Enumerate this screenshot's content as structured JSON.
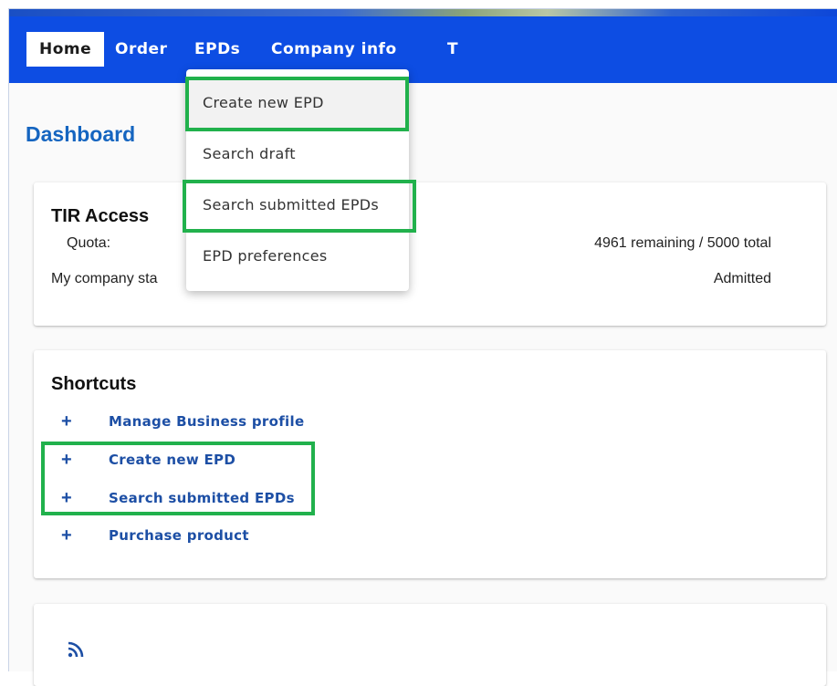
{
  "nav": {
    "items": [
      {
        "label": "Home",
        "active": true
      },
      {
        "label": "Order"
      },
      {
        "label": "EPDs"
      },
      {
        "label": "Company info"
      },
      {
        "label": "T"
      }
    ]
  },
  "dropdown": {
    "items": [
      {
        "label": "Create new EPD",
        "highlighted": true
      },
      {
        "label": "Search draft"
      },
      {
        "label": "Search submitted EPDs",
        "highlighted": true
      },
      {
        "label": "EPD preferences"
      }
    ]
  },
  "page": {
    "title": "Dashboard"
  },
  "tir_access": {
    "title": "TIR Access",
    "quota_label": "Quota:",
    "quota_value": "4961 remaining / 5000 total",
    "status_label": "My company sta",
    "status_value": "Admitted"
  },
  "shortcuts": {
    "title": "Shortcuts",
    "items": [
      {
        "icon": "plus-icon",
        "label": "Manage Business profile"
      },
      {
        "icon": "plus-icon",
        "label": "Create new EPD",
        "highlighted": true
      },
      {
        "icon": "plus-icon",
        "label": "Search submitted EPDs",
        "highlighted": true
      },
      {
        "icon": "plus-icon",
        "label": "Purchase product"
      }
    ]
  },
  "feed": {
    "icon": "rss-feed-icon"
  },
  "colors": {
    "navbar": "#0d4de3",
    "title": "#1565c0",
    "link": "#1d4fa5",
    "highlight": "#21b14c"
  }
}
